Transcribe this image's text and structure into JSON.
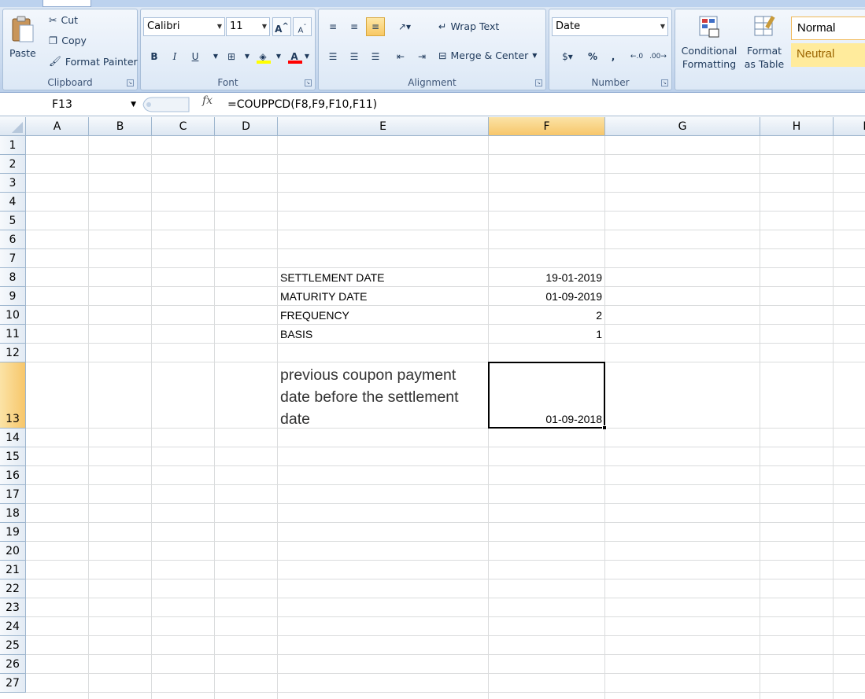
{
  "ribbon": {
    "clipboard": {
      "label": "Clipboard",
      "paste": "Paste",
      "cut": "Cut",
      "copy": "Copy",
      "format_painter": "Format Painter"
    },
    "font": {
      "label": "Font",
      "name": "Calibri",
      "size": "11",
      "grow": "A",
      "shrink": "A",
      "bold": "B",
      "italic": "I",
      "underline": "U",
      "fill_color": "#ffff00",
      "font_color": "#ff0000"
    },
    "alignment": {
      "label": "Alignment",
      "wrap_text": "Wrap Text",
      "merge_center": "Merge & Center"
    },
    "number": {
      "label": "Number",
      "format": "Date",
      "percent": "%",
      "comma": ","
    },
    "styles": {
      "conditional_formatting": "Conditional Formatting",
      "format_as_table": "Format as Table",
      "normal": "Normal",
      "neutral": "Neutral"
    }
  },
  "formula_bar": {
    "name_box": "F13",
    "fx": "fx",
    "formula": "=COUPPCD(F8,F9,F10,F11)"
  },
  "columns": [
    "A",
    "B",
    "C",
    "D",
    "E",
    "F",
    "G",
    "H",
    "I"
  ],
  "rows": [
    "1",
    "2",
    "3",
    "4",
    "5",
    "6",
    "7",
    "8",
    "9",
    "10",
    "11",
    "12",
    "13",
    "14",
    "15",
    "16",
    "17",
    "18",
    "19",
    "20",
    "21",
    "22",
    "23",
    "24",
    "25",
    "26",
    "27"
  ],
  "cells": {
    "E8": "SETTLEMENT DATE",
    "F8": "19-01-2019",
    "E9": "MATURITY DATE",
    "F9": "01-09-2019",
    "E10": "FREQUENCY",
    "F10": "2",
    "E11": "BASIS",
    "F11": "1",
    "E13": "previous coupon payment date before the settlement date",
    "F13": "01-09-2018"
  },
  "selection": {
    "active_cell": "F13",
    "selected_column": "F",
    "selected_row": "13"
  }
}
